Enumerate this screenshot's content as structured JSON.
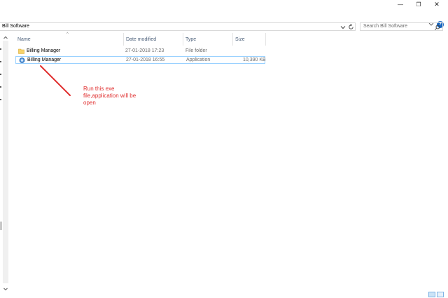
{
  "window": {
    "minimize_glyph": "—",
    "maximize_glyph": "❐",
    "close_glyph": "✕"
  },
  "address_bar": {
    "path": "Bill Software"
  },
  "search": {
    "placeholder": "Search Bill Software"
  },
  "columns": {
    "name": "Name",
    "date_modified": "Date modified",
    "type": "Type",
    "size": "Size"
  },
  "files": [
    {
      "name": "Billing Manager",
      "date": "27-01-2018 17:23",
      "type": "File folder",
      "size": "",
      "icon": "folder-icon"
    },
    {
      "name": "Billing Manager",
      "date": "27-01-2018 16:55",
      "type": "Application",
      "size": "10,390 KB",
      "icon": "application-icon"
    }
  ],
  "annotation": {
    "text": "Run this exe file,application will be open",
    "color": "#e03030"
  },
  "colors": {
    "accent": "#1565c0",
    "selection_border": "#99d1ff",
    "header_text": "#4c607a"
  }
}
